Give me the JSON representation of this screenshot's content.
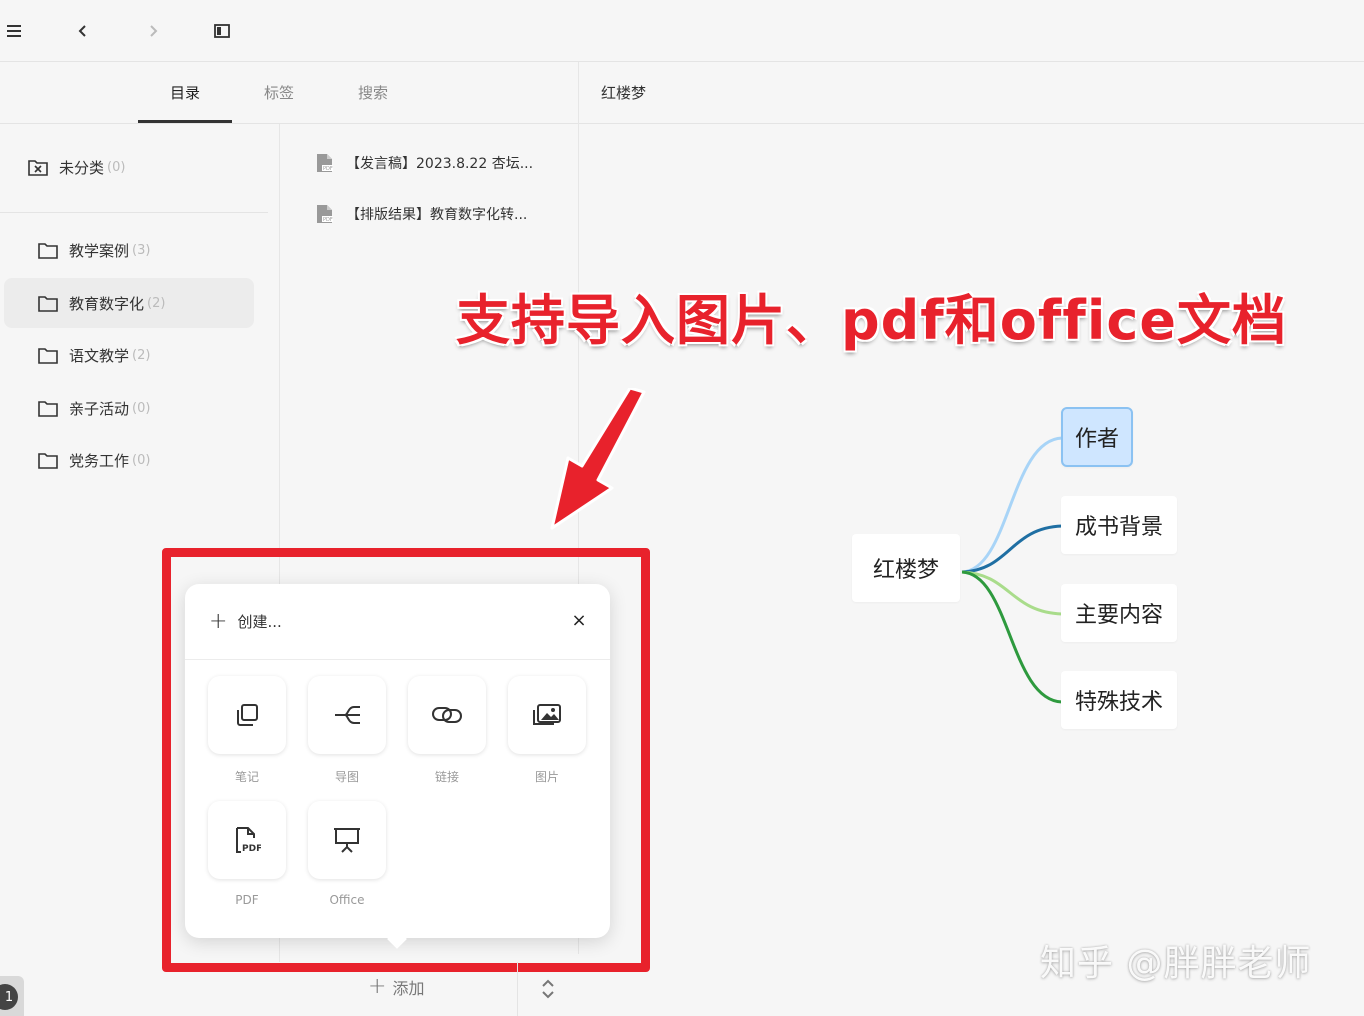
{
  "toolbar": {
    "menu_icon": "hamburger-icon",
    "back_icon": "chevron-left-icon",
    "forward_icon": "chevron-right-icon",
    "panel_icon": "sidebar-toggle-icon"
  },
  "tabs": [
    {
      "label": "目录",
      "active": true
    },
    {
      "label": "标签",
      "active": false
    },
    {
      "label": "搜索",
      "active": false
    }
  ],
  "document": {
    "title": "红楼梦"
  },
  "sidebar": {
    "uncategorized": {
      "label": "未分类",
      "count": "(0)"
    },
    "folders": [
      {
        "label": "教学案例",
        "count": "(3)"
      },
      {
        "label": "教育数字化",
        "count": "(2)",
        "selected": true
      },
      {
        "label": "语文教学",
        "count": "(2)"
      },
      {
        "label": "亲子活动",
        "count": "(0)"
      },
      {
        "label": "党务工作",
        "count": "(0)"
      }
    ]
  },
  "files": [
    {
      "name": "【发言稿】2023.8.22 杏坛..."
    },
    {
      "name": "【排版结果】教育数字化转..."
    }
  ],
  "annotation": {
    "headline": "支持导入图片、pdf和office文档",
    "color": "#e8222c"
  },
  "mindmap": {
    "root": "红楼梦",
    "children": [
      {
        "label": "作者",
        "color": "#a8d4f7",
        "highlighted": true
      },
      {
        "label": "成书背景",
        "color": "#1f6fa3"
      },
      {
        "label": "主要内容",
        "color": "#a9dc8b"
      },
      {
        "label": "特殊技术",
        "color": "#2e9a3e"
      }
    ]
  },
  "create_popup": {
    "title": "创建...",
    "close": "×",
    "items": [
      {
        "label": "笔记",
        "icon": "note-icon"
      },
      {
        "label": "导图",
        "icon": "mindmap-icon"
      },
      {
        "label": "链接",
        "icon": "link-icon"
      },
      {
        "label": "图片",
        "icon": "image-icon"
      },
      {
        "label": "PDF",
        "icon": "pdf-icon"
      },
      {
        "label": "Office",
        "icon": "presentation-icon"
      }
    ]
  },
  "bottombar": {
    "add_label": "添加"
  },
  "badge": {
    "value": "1"
  },
  "watermark": "知乎 @胖胖老师"
}
